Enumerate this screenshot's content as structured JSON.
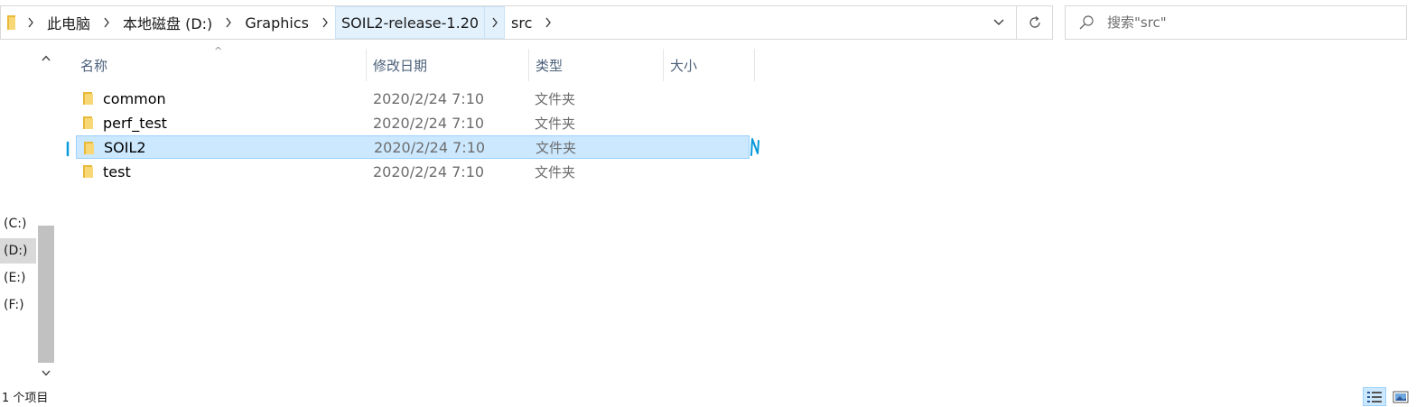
{
  "address_bar": {
    "crumbs": [
      "此电脑",
      "本地磁盘 (D:)",
      "Graphics",
      "SOIL2-release-1.20",
      "src"
    ],
    "refresh_icon": "refresh-icon",
    "dropdown_icon": "chevron-down-icon"
  },
  "search": {
    "placeholder": "搜索\"src\"",
    "icon": "search-icon"
  },
  "nav_pane": {
    "drives": [
      {
        "label": "(C:)",
        "selected": false
      },
      {
        "label": "(D:)",
        "selected": true
      },
      {
        "label": "(E:)",
        "selected": false
      },
      {
        "label": "(F:)",
        "selected": false
      }
    ]
  },
  "columns": {
    "name": "名称",
    "date": "修改日期",
    "type": "类型",
    "size": "大小"
  },
  "files": [
    {
      "name": "common",
      "date": "2020/2/24 7:10",
      "type": "文件夹",
      "selected": false
    },
    {
      "name": "perf_test",
      "date": "2020/2/24 7:10",
      "type": "文件夹",
      "selected": false
    },
    {
      "name": "SOIL2",
      "date": "2020/2/24 7:10",
      "type": "文件夹",
      "selected": true
    },
    {
      "name": "test",
      "date": "2020/2/24 7:10",
      "type": "文件夹",
      "selected": false
    }
  ],
  "status": {
    "count_text": "1 个项目"
  },
  "colors": {
    "selection_bg": "#cce8ff",
    "selection_border": "#99d1ff",
    "header_text": "#4c607a",
    "folder_yellow": "#f8d775",
    "ink_blue": "#0a9ad9"
  }
}
